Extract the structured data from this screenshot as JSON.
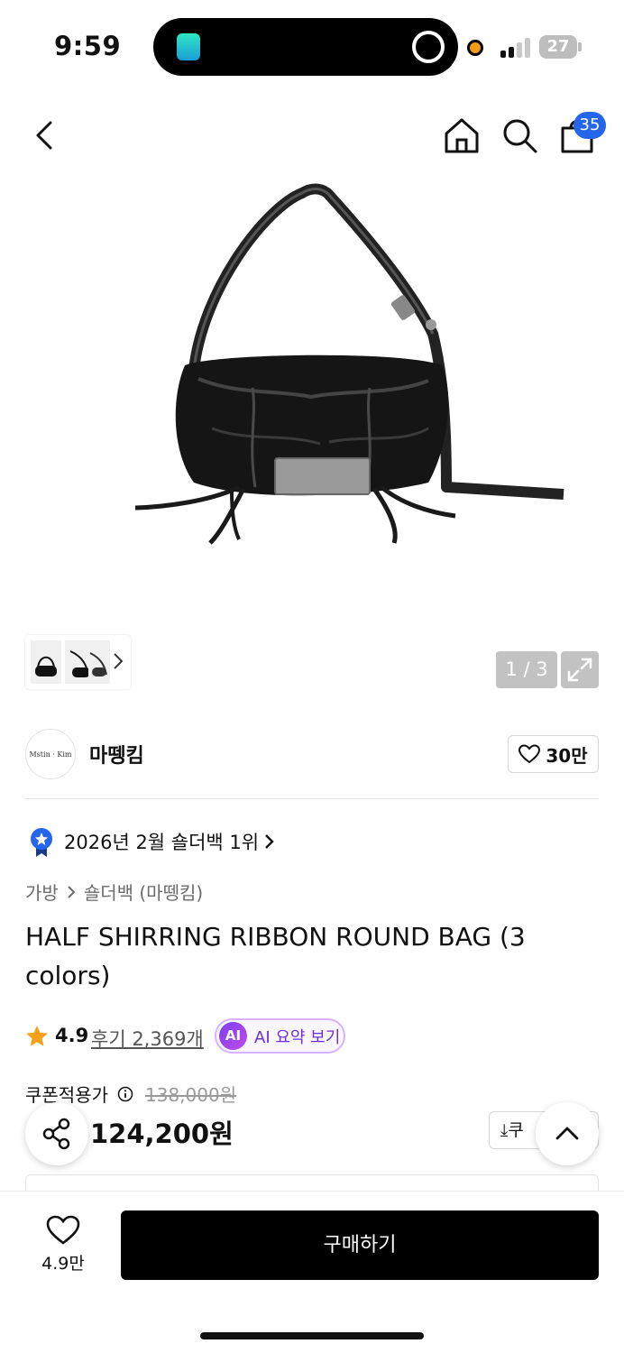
{
  "status_bar": {
    "time": "9:59",
    "battery": "27"
  },
  "header": {
    "cart_count": "35"
  },
  "gallery": {
    "counter": "1 / 3"
  },
  "brand": {
    "logo_text": "Mstin · Kim",
    "name": "마뗑킴",
    "likes": "30만"
  },
  "ranking": {
    "text": "2026년 2월 숄더백 1위"
  },
  "breadcrumb": {
    "level1": "가방",
    "level2": "숄더백 (마뗑킴)"
  },
  "product": {
    "title": "HALF SHIRRING RIBBON ROUND BAG (3 colors)",
    "rating": "4.9",
    "reviews": "후기 2,369개",
    "ai_badge": "AI",
    "ai_summary": "AI 요약 보기",
    "coupon_price_label": "쿠폰적용가",
    "original_price": "138,000원",
    "price": "124,200원",
    "coupon_button": "쿠"
  },
  "bottom_bar": {
    "wish_count": "4.9만",
    "buy_label": "구매하기"
  },
  "colors": {
    "accent_blue": "#2565ea",
    "ai_purple": "#7b3ff2",
    "star_orange": "#f7a11a",
    "buy_black": "#000000"
  }
}
